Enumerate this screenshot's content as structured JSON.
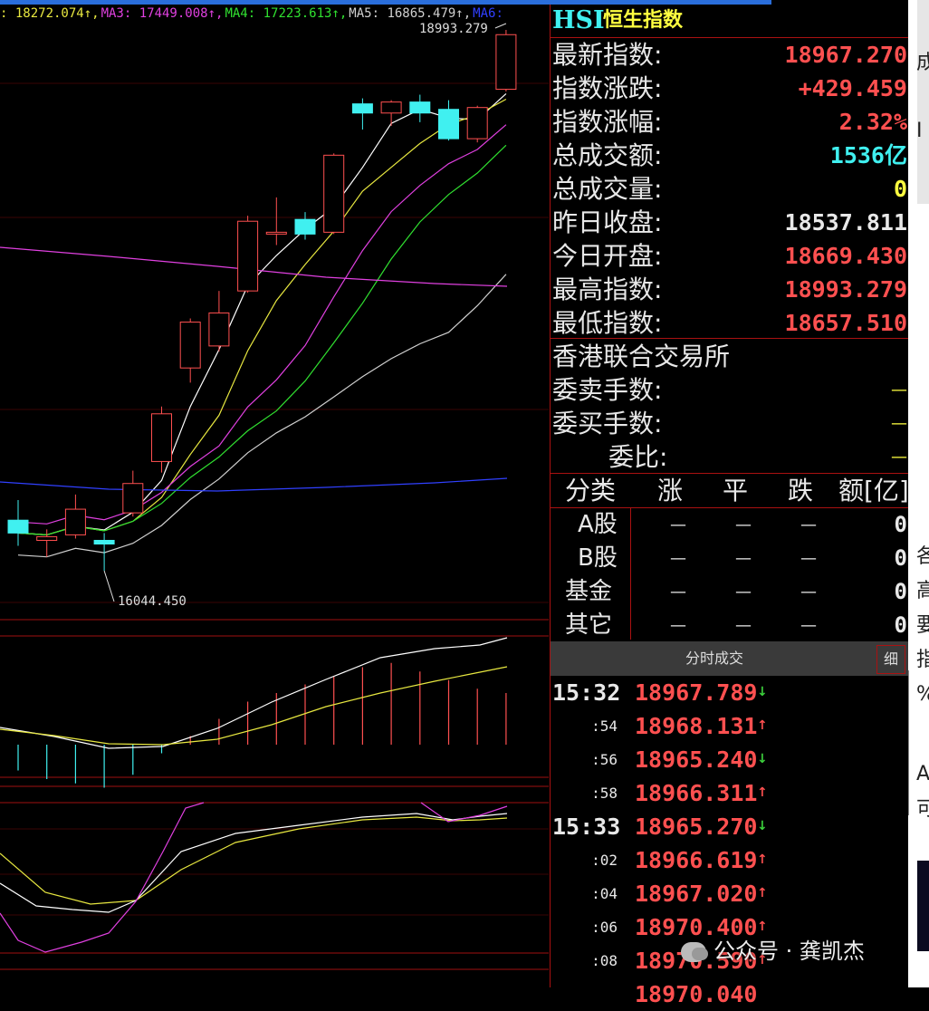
{
  "ma_legend": [
    {
      "text": ": 18272.074↑,",
      "color": "#e8e840"
    },
    {
      "text": "MA3: 17449.008↑,",
      "color": "#e040e0"
    },
    {
      "text": "MA4: 17223.613↑,",
      "color": "#30e030"
    },
    {
      "text": "MA5: 16865.479↑,",
      "color": "#d0d0d0"
    },
    {
      "text": "MA6:",
      "color": "#3040ff"
    }
  ],
  "high_label": "18993.279",
  "low_label": "16044.450",
  "candles": [
    {
      "o": 16320,
      "c": 16250,
      "h": 16430,
      "l": 16180
    },
    {
      "o": 16210,
      "c": 16230,
      "h": 16270,
      "l": 16120
    },
    {
      "o": 16240,
      "c": 16380,
      "h": 16460,
      "l": 16220
    },
    {
      "o": 16210,
      "c": 16190,
      "h": 16250,
      "l": 16044.45
    },
    {
      "o": 16360,
      "c": 16520,
      "h": 16590,
      "l": 16340
    },
    {
      "o": 16640,
      "c": 16900,
      "h": 16940,
      "l": 16580
    },
    {
      "o": 17150,
      "c": 17400,
      "h": 17420,
      "l": 17070
    },
    {
      "o": 17270,
      "c": 17450,
      "h": 17570,
      "l": 17240
    },
    {
      "o": 17570,
      "c": 17950,
      "h": 17980,
      "l": 17560
    },
    {
      "o": 17880,
      "c": 17890,
      "h": 18080,
      "l": 17820
    },
    {
      "o": 17960,
      "c": 17880,
      "h": 18000,
      "l": 17850
    },
    {
      "o": 17890,
      "c": 18310,
      "h": 18320,
      "l": 17880
    },
    {
      "o": 18590,
      "c": 18540,
      "h": 18620,
      "l": 18450
    },
    {
      "o": 18540,
      "c": 18600,
      "h": 18610,
      "l": 18470
    },
    {
      "o": 18600,
      "c": 18540,
      "h": 18640,
      "l": 18490
    },
    {
      "o": 18560,
      "c": 18400,
      "h": 18610,
      "l": 18390
    },
    {
      "o": 18400,
      "c": 18570,
      "h": 18580,
      "l": 18380
    },
    {
      "o": 18669.43,
      "c": 18967.27,
      "h": 18993.279,
      "l": 18657.51
    }
  ],
  "panel": {
    "code": "HSI",
    "name": "恒生指数",
    "stats": [
      {
        "label": "最新指数:",
        "value": "18967.270",
        "color": "red"
      },
      {
        "label": "指数涨跌:",
        "value": "+429.459",
        "color": "red"
      },
      {
        "label": "指数涨幅:",
        "value": "2.32%",
        "color": "red"
      },
      {
        "label": "总成交额:",
        "value": "1536亿",
        "color": "cyan"
      },
      {
        "label": "总成交量:",
        "value": "0",
        "color": "yel"
      },
      {
        "label": "昨日收盘:",
        "value": "18537.811",
        "color": "wht"
      },
      {
        "label": "今日开盘:",
        "value": "18669.430",
        "color": "red"
      },
      {
        "label": "最高指数:",
        "value": "18993.279",
        "color": "red"
      },
      {
        "label": "最低指数:",
        "value": "18657.510",
        "color": "red"
      }
    ],
    "exchange": "香港联合交易所",
    "order_rows": [
      {
        "label": "委卖手数:",
        "value": "—"
      },
      {
        "label": "委买手数:",
        "value": "—"
      },
      {
        "label": "委比:",
        "value": "—"
      }
    ],
    "grid_headers": [
      "分类",
      "涨",
      "平",
      "跌",
      "额[亿]"
    ],
    "categories": [
      {
        "name": "A股",
        "up": "—",
        "flat": "—",
        "down": "—",
        "amount": "0"
      },
      {
        "name": "B股",
        "up": "—",
        "flat": "—",
        "down": "—",
        "amount": "0"
      },
      {
        "name": "基金",
        "up": "—",
        "flat": "—",
        "down": "—",
        "amount": "0"
      },
      {
        "name": "其它",
        "up": "—",
        "flat": "—",
        "down": "—",
        "amount": "0"
      }
    ],
    "tick_title": "分时成交",
    "tick_detail": "细",
    "ticks": [
      {
        "time": "15:32",
        "big": true,
        "price": "18967.789",
        "dir": "down"
      },
      {
        "time": ":54",
        "big": false,
        "price": "18968.131",
        "dir": "up"
      },
      {
        "time": ":56",
        "big": false,
        "price": "18965.240",
        "dir": "down"
      },
      {
        "time": ":58",
        "big": false,
        "price": "18966.311",
        "dir": "up"
      },
      {
        "time": "15:33",
        "big": true,
        "price": "18965.270",
        "dir": "down"
      },
      {
        "time": ":02",
        "big": false,
        "price": "18966.619",
        "dir": "up"
      },
      {
        "time": ":04",
        "big": false,
        "price": "18967.020",
        "dir": "up"
      },
      {
        "time": ":06",
        "big": false,
        "price": "18970.400",
        "dir": "up"
      },
      {
        "time": ":08",
        "big": false,
        "price": "18970.590",
        "dir": "up"
      },
      {
        "time": "",
        "big": false,
        "price": "18970.040",
        "dir": ""
      }
    ]
  },
  "side_strip_chars": [
    "成",
    "I",
    "各",
    "高",
    "要",
    "指",
    "%",
    "A",
    "可"
  ],
  "watermark": "公众号 · 龚凯杰",
  "colors": {
    "up": "#ff5050",
    "down": "#40f0f0",
    "grid_line": "#a11111"
  }
}
